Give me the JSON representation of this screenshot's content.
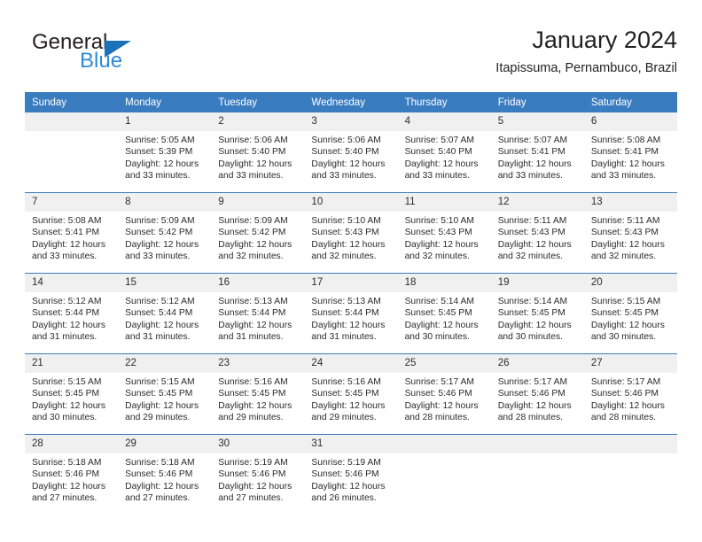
{
  "brand": {
    "name_part1": "General",
    "name_part2": "Blue",
    "triangle_color": "#1b72b8",
    "blue_color": "#2e8bd6"
  },
  "header": {
    "title": "January 2024",
    "subtitle": "Itapissuma, Pernambuco, Brazil"
  },
  "theme": {
    "header_bg": "#3a7cc0",
    "header_text": "#ffffff",
    "daynum_bg": "#f0f0f0",
    "rule_color": "#3a7cc0",
    "body_text": "#2b2b2b"
  },
  "weekdays": [
    "Sunday",
    "Monday",
    "Tuesday",
    "Wednesday",
    "Thursday",
    "Friday",
    "Saturday"
  ],
  "weeks": [
    [
      {
        "day": "",
        "sunrise": "",
        "sunset": "",
        "daylight_line1": "",
        "daylight_line2": ""
      },
      {
        "day": "1",
        "sunrise": "Sunrise: 5:05 AM",
        "sunset": "Sunset: 5:39 PM",
        "daylight_line1": "Daylight: 12 hours",
        "daylight_line2": "and 33 minutes."
      },
      {
        "day": "2",
        "sunrise": "Sunrise: 5:06 AM",
        "sunset": "Sunset: 5:40 PM",
        "daylight_line1": "Daylight: 12 hours",
        "daylight_line2": "and 33 minutes."
      },
      {
        "day": "3",
        "sunrise": "Sunrise: 5:06 AM",
        "sunset": "Sunset: 5:40 PM",
        "daylight_line1": "Daylight: 12 hours",
        "daylight_line2": "and 33 minutes."
      },
      {
        "day": "4",
        "sunrise": "Sunrise: 5:07 AM",
        "sunset": "Sunset: 5:40 PM",
        "daylight_line1": "Daylight: 12 hours",
        "daylight_line2": "and 33 minutes."
      },
      {
        "day": "5",
        "sunrise": "Sunrise: 5:07 AM",
        "sunset": "Sunset: 5:41 PM",
        "daylight_line1": "Daylight: 12 hours",
        "daylight_line2": "and 33 minutes."
      },
      {
        "day": "6",
        "sunrise": "Sunrise: 5:08 AM",
        "sunset": "Sunset: 5:41 PM",
        "daylight_line1": "Daylight: 12 hours",
        "daylight_line2": "and 33 minutes."
      }
    ],
    [
      {
        "day": "7",
        "sunrise": "Sunrise: 5:08 AM",
        "sunset": "Sunset: 5:41 PM",
        "daylight_line1": "Daylight: 12 hours",
        "daylight_line2": "and 33 minutes."
      },
      {
        "day": "8",
        "sunrise": "Sunrise: 5:09 AM",
        "sunset": "Sunset: 5:42 PM",
        "daylight_line1": "Daylight: 12 hours",
        "daylight_line2": "and 33 minutes."
      },
      {
        "day": "9",
        "sunrise": "Sunrise: 5:09 AM",
        "sunset": "Sunset: 5:42 PM",
        "daylight_line1": "Daylight: 12 hours",
        "daylight_line2": "and 32 minutes."
      },
      {
        "day": "10",
        "sunrise": "Sunrise: 5:10 AM",
        "sunset": "Sunset: 5:43 PM",
        "daylight_line1": "Daylight: 12 hours",
        "daylight_line2": "and 32 minutes."
      },
      {
        "day": "11",
        "sunrise": "Sunrise: 5:10 AM",
        "sunset": "Sunset: 5:43 PM",
        "daylight_line1": "Daylight: 12 hours",
        "daylight_line2": "and 32 minutes."
      },
      {
        "day": "12",
        "sunrise": "Sunrise: 5:11 AM",
        "sunset": "Sunset: 5:43 PM",
        "daylight_line1": "Daylight: 12 hours",
        "daylight_line2": "and 32 minutes."
      },
      {
        "day": "13",
        "sunrise": "Sunrise: 5:11 AM",
        "sunset": "Sunset: 5:43 PM",
        "daylight_line1": "Daylight: 12 hours",
        "daylight_line2": "and 32 minutes."
      }
    ],
    [
      {
        "day": "14",
        "sunrise": "Sunrise: 5:12 AM",
        "sunset": "Sunset: 5:44 PM",
        "daylight_line1": "Daylight: 12 hours",
        "daylight_line2": "and 31 minutes."
      },
      {
        "day": "15",
        "sunrise": "Sunrise: 5:12 AM",
        "sunset": "Sunset: 5:44 PM",
        "daylight_line1": "Daylight: 12 hours",
        "daylight_line2": "and 31 minutes."
      },
      {
        "day": "16",
        "sunrise": "Sunrise: 5:13 AM",
        "sunset": "Sunset: 5:44 PM",
        "daylight_line1": "Daylight: 12 hours",
        "daylight_line2": "and 31 minutes."
      },
      {
        "day": "17",
        "sunrise": "Sunrise: 5:13 AM",
        "sunset": "Sunset: 5:44 PM",
        "daylight_line1": "Daylight: 12 hours",
        "daylight_line2": "and 31 minutes."
      },
      {
        "day": "18",
        "sunrise": "Sunrise: 5:14 AM",
        "sunset": "Sunset: 5:45 PM",
        "daylight_line1": "Daylight: 12 hours",
        "daylight_line2": "and 30 minutes."
      },
      {
        "day": "19",
        "sunrise": "Sunrise: 5:14 AM",
        "sunset": "Sunset: 5:45 PM",
        "daylight_line1": "Daylight: 12 hours",
        "daylight_line2": "and 30 minutes."
      },
      {
        "day": "20",
        "sunrise": "Sunrise: 5:15 AM",
        "sunset": "Sunset: 5:45 PM",
        "daylight_line1": "Daylight: 12 hours",
        "daylight_line2": "and 30 minutes."
      }
    ],
    [
      {
        "day": "21",
        "sunrise": "Sunrise: 5:15 AM",
        "sunset": "Sunset: 5:45 PM",
        "daylight_line1": "Daylight: 12 hours",
        "daylight_line2": "and 30 minutes."
      },
      {
        "day": "22",
        "sunrise": "Sunrise: 5:15 AM",
        "sunset": "Sunset: 5:45 PM",
        "daylight_line1": "Daylight: 12 hours",
        "daylight_line2": "and 29 minutes."
      },
      {
        "day": "23",
        "sunrise": "Sunrise: 5:16 AM",
        "sunset": "Sunset: 5:45 PM",
        "daylight_line1": "Daylight: 12 hours",
        "daylight_line2": "and 29 minutes."
      },
      {
        "day": "24",
        "sunrise": "Sunrise: 5:16 AM",
        "sunset": "Sunset: 5:45 PM",
        "daylight_line1": "Daylight: 12 hours",
        "daylight_line2": "and 29 minutes."
      },
      {
        "day": "25",
        "sunrise": "Sunrise: 5:17 AM",
        "sunset": "Sunset: 5:46 PM",
        "daylight_line1": "Daylight: 12 hours",
        "daylight_line2": "and 28 minutes."
      },
      {
        "day": "26",
        "sunrise": "Sunrise: 5:17 AM",
        "sunset": "Sunset: 5:46 PM",
        "daylight_line1": "Daylight: 12 hours",
        "daylight_line2": "and 28 minutes."
      },
      {
        "day": "27",
        "sunrise": "Sunrise: 5:17 AM",
        "sunset": "Sunset: 5:46 PM",
        "daylight_line1": "Daylight: 12 hours",
        "daylight_line2": "and 28 minutes."
      }
    ],
    [
      {
        "day": "28",
        "sunrise": "Sunrise: 5:18 AM",
        "sunset": "Sunset: 5:46 PM",
        "daylight_line1": "Daylight: 12 hours",
        "daylight_line2": "and 27 minutes."
      },
      {
        "day": "29",
        "sunrise": "Sunrise: 5:18 AM",
        "sunset": "Sunset: 5:46 PM",
        "daylight_line1": "Daylight: 12 hours",
        "daylight_line2": "and 27 minutes."
      },
      {
        "day": "30",
        "sunrise": "Sunrise: 5:19 AM",
        "sunset": "Sunset: 5:46 PM",
        "daylight_line1": "Daylight: 12 hours",
        "daylight_line2": "and 27 minutes."
      },
      {
        "day": "31",
        "sunrise": "Sunrise: 5:19 AM",
        "sunset": "Sunset: 5:46 PM",
        "daylight_line1": "Daylight: 12 hours",
        "daylight_line2": "and 26 minutes."
      },
      {
        "day": "",
        "sunrise": "",
        "sunset": "",
        "daylight_line1": "",
        "daylight_line2": ""
      },
      {
        "day": "",
        "sunrise": "",
        "sunset": "",
        "daylight_line1": "",
        "daylight_line2": ""
      },
      {
        "day": "",
        "sunrise": "",
        "sunset": "",
        "daylight_line1": "",
        "daylight_line2": ""
      }
    ]
  ]
}
